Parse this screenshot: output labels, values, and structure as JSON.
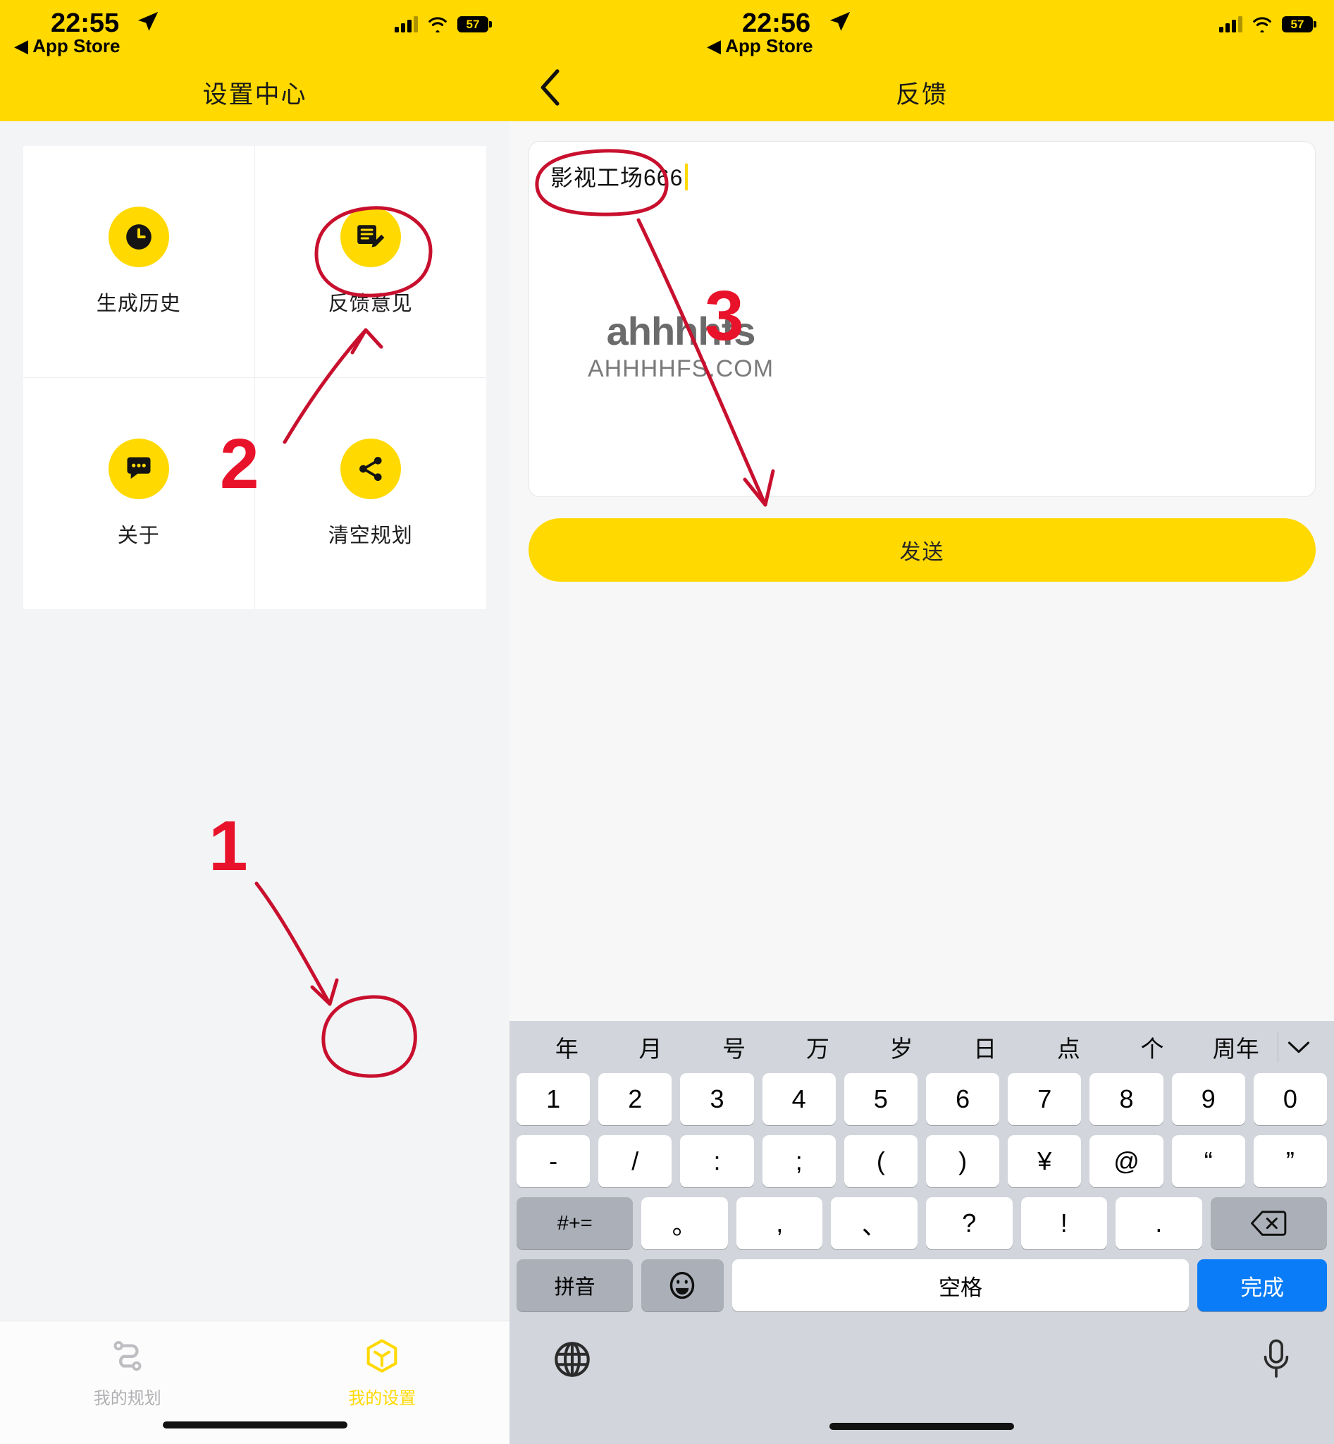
{
  "screens": [
    {
      "id": "settings",
      "statusbar": {
        "time": "22:55",
        "back_app": "App Store",
        "battery": "57",
        "location_icon": "location-arrow-icon",
        "wifi_icon": "wifi-icon",
        "signal_icon": "cellular-signal-icon"
      },
      "navbar": {
        "title": "设置中心"
      },
      "grid": [
        {
          "label": "生成历史",
          "icon": "clock-icon"
        },
        {
          "label": "反馈意见",
          "icon": "feedback-edit-icon"
        },
        {
          "label": "关于",
          "icon": "chat-bubble-icon"
        },
        {
          "label": "清空规划",
          "icon": "share-icon"
        }
      ],
      "tabbar": [
        {
          "label": "我的规划",
          "icon": "route-icon",
          "active": false
        },
        {
          "label": "我的设置",
          "icon": "cube-icon",
          "active": true
        }
      ]
    },
    {
      "id": "feedback",
      "statusbar": {
        "time": "22:56",
        "back_app": "App Store",
        "battery": "57",
        "location_icon": "location-arrow-icon",
        "wifi_icon": "wifi-icon",
        "signal_icon": "cellular-signal-icon"
      },
      "navbar": {
        "title": "反馈",
        "back_icon": "chevron-left-icon"
      },
      "textarea": {
        "value": "影视工场666",
        "placeholder": ""
      },
      "send_button": {
        "label": "发送"
      },
      "watermark": {
        "line1": "ahhhhfs",
        "line2": "AHHHHFS.COM"
      },
      "keyboard": {
        "candidates": [
          "年",
          "月",
          "号",
          "万",
          "岁",
          "日",
          "点",
          "个",
          "周年"
        ],
        "collapse_icon": "chevron-down-icon",
        "row_numbers": [
          "1",
          "2",
          "3",
          "4",
          "5",
          "6",
          "7",
          "8",
          "9",
          "0"
        ],
        "row_symbols": [
          "-",
          "/",
          ":",
          ";",
          "(",
          ")",
          "¥",
          "@",
          "“",
          "”"
        ],
        "row_punct": {
          "shift_label": "#+=",
          "keys": [
            "。",
            ",",
            "、",
            "?",
            "!",
            "."
          ],
          "backspace_icon": "backspace-icon"
        },
        "row_bottom": {
          "pinyin_label": "拼音",
          "emoji_icon": "emoji-smiley-icon",
          "space_label": "空格",
          "done_label": "完成"
        },
        "bottom_bar": {
          "globe_icon": "globe-icon",
          "mic_icon": "microphone-icon"
        }
      }
    }
  ],
  "annotations": {
    "steps": [
      {
        "number": "1",
        "target": "我的设置"
      },
      {
        "number": "2",
        "target": "反馈意见"
      },
      {
        "number": "3",
        "target": "发送"
      }
    ],
    "color": "#E8122A"
  }
}
